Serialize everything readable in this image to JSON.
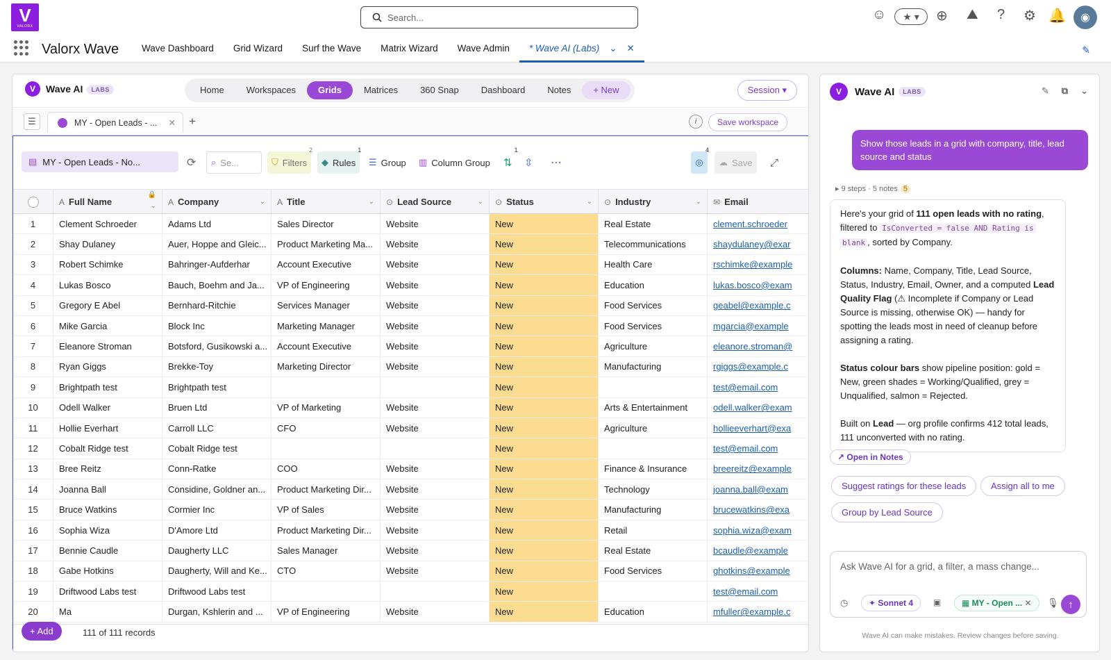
{
  "brand": {
    "logo_text": "VALORX",
    "app_name": "Valorx Wave"
  },
  "search": {
    "placeholder": "Search..."
  },
  "nav": {
    "tabs": [
      "Wave Dashboard",
      "Grid Wizard",
      "Surf the Wave",
      "Matrix Wizard",
      "Wave Admin"
    ],
    "active_tab": "* Wave AI (Labs)"
  },
  "wave": {
    "title": "Wave AI",
    "labs": "LABS",
    "nav": [
      "Home",
      "Workspaces",
      "Grids",
      "Matrices",
      "360 Snap",
      "Dashboard",
      "Notes"
    ],
    "active": "Grids",
    "new_label": "+ New",
    "session_label": "Session ▾"
  },
  "tabbar": {
    "grid_tab": "MY - Open Leads - ...",
    "save_workspace": "Save workspace"
  },
  "toolbar": {
    "grid_select": "MY - Open Leads - No...",
    "search_ph": "Se...",
    "filters": "Filters",
    "filters_count": "2",
    "rules": "Rules",
    "rules_count": "1",
    "group": "Group",
    "column_group": "Column Group",
    "sort_count": "1",
    "hidden_count": "4",
    "save": "Save"
  },
  "grid": {
    "columns": [
      "Full Name",
      "Company",
      "Title",
      "Lead Source",
      "Status",
      "Industry",
      "Email"
    ],
    "rows": [
      [
        "1",
        "Clement Schroeder",
        "Adams Ltd",
        "Sales Director",
        "Website",
        "New",
        "Real Estate",
        "clement.schroeder"
      ],
      [
        "2",
        "Shay Dulaney",
        "Auer, Hoppe and Gleic...",
        "Product Marketing Ma...",
        "Website",
        "New",
        "Telecommunications",
        "shaydulaney@exar"
      ],
      [
        "3",
        "Robert Schimke",
        "Bahringer-Aufderhar",
        "Account Executive",
        "Website",
        "New",
        "Health Care",
        "rschimke@example"
      ],
      [
        "4",
        "Lukas Bosco",
        "Bauch, Boehm and Ja...",
        "VP of Engineering",
        "Website",
        "New",
        "Education",
        "lukas.bosco@exam"
      ],
      [
        "5",
        "Gregory E Abel",
        "Bernhard-Ritchie",
        "Services Manager",
        "Website",
        "New",
        "Food Services",
        "geabel@example.c"
      ],
      [
        "6",
        "Mike Garcia",
        "Block Inc",
        "Marketing Manager",
        "Website",
        "New",
        "Food Services",
        "mgarcia@example"
      ],
      [
        "7",
        "Eleanore Stroman",
        "Botsford, Gusikowski a...",
        "Account Executive",
        "Website",
        "New",
        "Agriculture",
        "eleanore.stroman@"
      ],
      [
        "8",
        "Ryan Giggs",
        "Brekke-Toy",
        "Marketing Director",
        "Website",
        "New",
        "Manufacturing",
        "rgiggs@example.c"
      ],
      [
        "9",
        "Brightpath test",
        "Brightpath test",
        "",
        "",
        "New",
        "",
        "test@email.com"
      ],
      [
        "10",
        "Odell Walker",
        "Bruen Ltd",
        "VP of Marketing",
        "Website",
        "New",
        "Arts & Entertainment",
        "odell.walker@exam"
      ],
      [
        "11",
        "Hollie Everhart",
        "Carroll LLC",
        "CFO",
        "Website",
        "New",
        "Agriculture",
        "hollieeverhart@exa"
      ],
      [
        "12",
        "Cobalt Ridge test",
        "Cobalt Ridge test",
        "",
        "",
        "New",
        "",
        "test@email.com"
      ],
      [
        "13",
        "Bree Reitz",
        "Conn-Ratke",
        "COO",
        "Website",
        "New",
        "Finance & Insurance",
        "breereitz@example"
      ],
      [
        "14",
        "Joanna Ball",
        "Considine, Goldner an...",
        "Product Marketing Dir...",
        "Website",
        "New",
        "Technology",
        "joanna.ball@exam"
      ],
      [
        "15",
        "Bruce Watkins",
        "Cormier Inc",
        "VP of Sales",
        "Website",
        "New",
        "Manufacturing",
        "brucewatkins@exa"
      ],
      [
        "16",
        "Sophia Wiza",
        "D'Amore Ltd",
        "Product Marketing Dir...",
        "Website",
        "New",
        "Retail",
        "sophia.wiza@exam"
      ],
      [
        "17",
        "Bennie Caudle",
        "Daugherty LLC",
        "Sales Manager",
        "Website",
        "New",
        "Real Estate",
        "bcaudle@example"
      ],
      [
        "18",
        "Gabe Hotkins",
        "Daugherty, Will and Ke...",
        "CTO",
        "Website",
        "New",
        "Food Services",
        "ghotkins@example"
      ],
      [
        "19",
        "Driftwood Labs test",
        "Driftwood Labs test",
        "",
        "",
        "New",
        "",
        "test@email.com"
      ],
      [
        "20",
        "Ma",
        "Durgan, Kshlerin and ...",
        "VP of Engineering",
        "Website",
        "New",
        "Education",
        "mfuller@example.c"
      ]
    ],
    "add_label": "+ Add",
    "records": "111 of 111 records"
  },
  "chat": {
    "title": "Wave AI",
    "labs": "LABS",
    "user_msg": "Show those leads in a grid with company, title, lead source and status",
    "steps": "9 steps · 5 notes",
    "steps_badge": "5",
    "a1_pre": "Here's your grid of ",
    "a1_bold": "111 open leads with no rating",
    "a1_mid": ", filtered to ",
    "a1_code1": "IsConverted = false AND Rating is",
    "a1_code2": "blank",
    "a1_post": ", sorted by Company.",
    "a2_bold": "Columns:",
    "a2_text": " Name, Company, Title, Lead Source, Status, Industry, Email, Owner, and a computed ",
    "a2_bold2": "Lead Quality Flag",
    "a2_text2": " (⚠ Incomplete if Company or Lead Source is missing, otherwise OK) — handy for spotting the leads most in need of cleanup before assigning a rating.",
    "a3_bold": "Status colour bars",
    "a3_text": " show pipeline position: gold = New, green shades = Working/Qualified, grey = Unqualified, salmon = Rejected.",
    "a4_pre": "Built on ",
    "a4_bold": "Lead",
    "a4_post": " — org profile confirms 412 total leads, 111 unconverted with no rating.",
    "open_notes": "↗ Open in Notes",
    "suggestions": [
      "Suggest ratings for these leads",
      "Assign all to me",
      "Group by Lead Source"
    ],
    "input_ph": "Ask Wave AI for a grid, a filter, a mass change...",
    "model": "✦ Sonnet 4",
    "context": "MY - Open ...",
    "disclaimer": "Wave AI can make mistakes. Review changes before saving."
  },
  "colors": {
    "accent": "#9a49d6",
    "status_new": "#fcdc91",
    "link": "#1b5fb0"
  }
}
